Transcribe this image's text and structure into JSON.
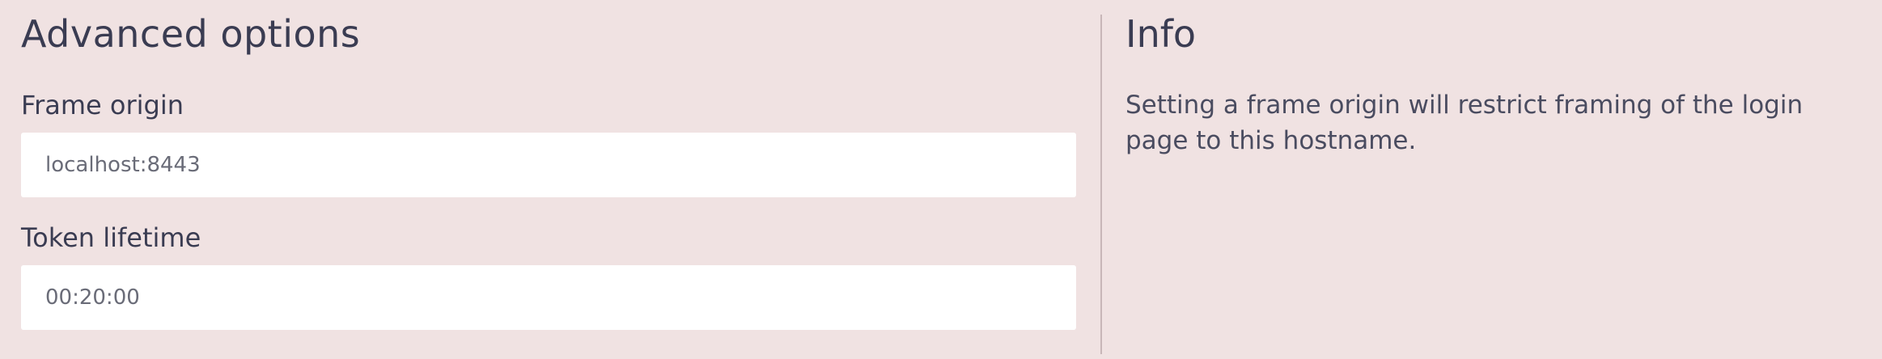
{
  "advanced": {
    "title": "Advanced options",
    "frame_origin": {
      "label": "Frame origin",
      "value": "localhost:8443"
    },
    "token_lifetime": {
      "label": "Token lifetime",
      "value": "00:20:00"
    }
  },
  "info": {
    "title": "Info",
    "text": "Setting a frame origin will restrict framing of the login page to this hostname."
  }
}
